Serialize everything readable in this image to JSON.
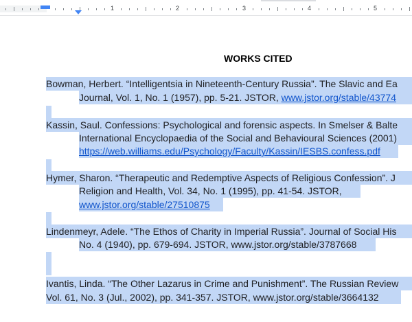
{
  "ruler": {
    "numbers": [
      "1",
      "2",
      "3",
      "4",
      "5"
    ]
  },
  "document": {
    "title": "WORKS CITED",
    "entries": [
      {
        "line1": "Bowman, Herbert. “Intelligentsia in Nineteenth-Century Russia”. The Slavic and Ea",
        "line2_text": "Journal, Vol. 1, No. 1 (1957), pp. 5-21. JSTOR, ",
        "line2_link": "www.jstor.org/stable/43774"
      },
      {
        "line1": "Kassin, Saul. Confessions: Psychological and forensic aspects. In Smelser & Balte",
        "line2": "International Encyclopaedia of the Social and Behavioural Sciences (2001)",
        "line3_link": "https://web.williams.edu/Psychology/Faculty/Kassin/IESBS.confess.pdf"
      },
      {
        "line1": "Hymer, Sharon. “Therapeutic and Redemptive Aspects of Religious Confession”. J",
        "line2": "Religion and Health, Vol. 34, No. 1 (1995), pp. 41-54. JSTOR,",
        "line3_link": "www.jstor.org/stable/27510875"
      },
      {
        "line1": "Lindenmeyr, Adele. “The Ethos of Charity in Imperial Russia”. Journal of Social His",
        "line2": "No. 4 (1940), pp. 679-694. JSTOR, www.jstor.org/stable/3787668"
      },
      {
        "line1": "Ivantis, Linda. “The Other Lazarus in Crime and Punishment”. The Russian Review",
        "line2": "Vol. 61, No. 3 (Jul., 2002), pp. 341-357. JSTOR, www.jstor.org/stable/3664132"
      }
    ]
  },
  "colors": {
    "selection": "#c2d7f6",
    "link": "#1155cc",
    "ruler_accent": "#4285f4"
  }
}
